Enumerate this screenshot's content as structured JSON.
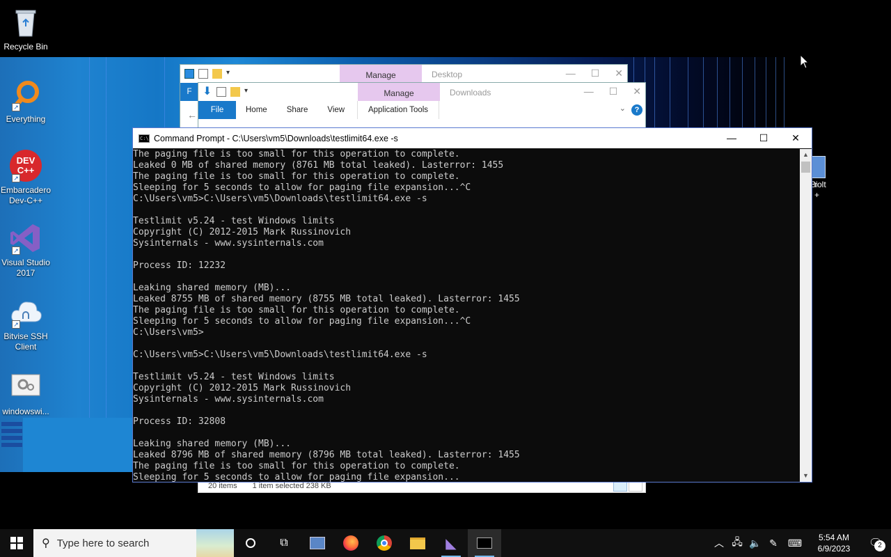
{
  "desktop_icons": [
    {
      "name": "recycle-bin",
      "label": "Recycle Bin"
    },
    {
      "name": "everything",
      "label": "Everything"
    },
    {
      "name": "devcpp",
      "label": "Embarcadero Dev-C++",
      "badge": "DEV C++"
    },
    {
      "name": "visual-studio",
      "label": "Visual Studio 2017"
    },
    {
      "name": "bitvise",
      "label": "Bitvise SSH Client"
    },
    {
      "name": "windowswi",
      "label": "windowswi..."
    }
  ],
  "rhs_icon_label_1": "Bi",
  "rhs_icon_label_2": "rolt",
  "rhs_icon_label_3": "+",
  "explorer_desktop": {
    "manage_label": "Manage",
    "title": "Desktop",
    "file_tab_partial": "F"
  },
  "explorer_downloads": {
    "manage_label": "Manage",
    "title": "Downloads",
    "ribbon": {
      "file": "File",
      "home": "Home",
      "share": "Share",
      "view": "View",
      "app_tools": "Application Tools"
    },
    "help": "?",
    "status": {
      "items": "20 items",
      "selected": "1 item selected  238 KB"
    }
  },
  "cmd": {
    "title": "Command Prompt - C:\\Users\\vm5\\Downloads\\testlimit64.exe  -s",
    "icon_text": "C:\\",
    "lines": [
      "The paging file is too small for this operation to complete.",
      "Leaked 0 MB of shared memory (8761 MB total leaked). Lasterror: 1455",
      "The paging file is too small for this operation to complete.",
      "Sleeping for 5 seconds to allow for paging file expansion...^C",
      "C:\\Users\\vm5>C:\\Users\\vm5\\Downloads\\testlimit64.exe -s",
      "",
      "Testlimit v5.24 - test Windows limits",
      "Copyright (C) 2012-2015 Mark Russinovich",
      "Sysinternals - www.sysinternals.com",
      "",
      "Process ID: 12232",
      "",
      "Leaking shared memory (MB)...",
      "Leaked 8755 MB of shared memory (8755 MB total leaked). Lasterror: 1455",
      "The paging file is too small for this operation to complete.",
      "Sleeping for 5 seconds to allow for paging file expansion...^C",
      "C:\\Users\\vm5>",
      "",
      "C:\\Users\\vm5>C:\\Users\\vm5\\Downloads\\testlimit64.exe -s",
      "",
      "Testlimit v5.24 - test Windows limits",
      "Copyright (C) 2012-2015 Mark Russinovich",
      "Sysinternals - www.sysinternals.com",
      "",
      "Process ID: 32808",
      "",
      "Leaking shared memory (MB)...",
      "Leaked 8796 MB of shared memory (8796 MB total leaked). Lasterror: 1455",
      "The paging file is too small for this operation to complete.",
      "Sleeping for 5 seconds to allow for paging file expansion..."
    ]
  },
  "taskbar": {
    "search_placeholder": "Type here to search",
    "clock_time": "5:54 AM",
    "clock_date": "6/9/2023",
    "notification_count": "2"
  },
  "colors": {
    "accent": "#1979ca",
    "console_bg": "#0c0c0c",
    "console_fg": "#cccccc",
    "manage_tab": "#e6c8ee"
  }
}
